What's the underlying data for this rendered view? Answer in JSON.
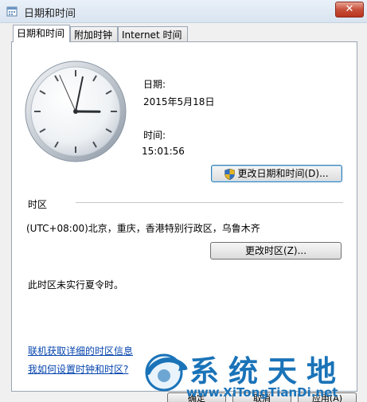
{
  "window": {
    "title": "日期和时间",
    "close_label": "✕"
  },
  "tabs": [
    {
      "label": "日期和时间"
    },
    {
      "label": "附加时钟"
    },
    {
      "label": "Internet 时间"
    }
  ],
  "clock": {
    "hour": 15,
    "minute": 1,
    "second": 56
  },
  "date": {
    "label": "日期:",
    "value": "2015年5月18日"
  },
  "time": {
    "label": "时间:",
    "value": "15:01:56"
  },
  "change_datetime_button": "更改日期和时间(D)...",
  "timezone": {
    "section_label": "时区",
    "value": "(UTC+08:00)北京，重庆，香港特别行政区，乌鲁木齐",
    "change_button": "更改时区(Z)...",
    "dst_note": "此时区未实行夏令时。"
  },
  "links": {
    "timezone_info": "联机获取详细的时区信息",
    "how_to_set": "我如何设置时钟和时区?"
  },
  "bottom_buttons": [
    {
      "label": "确定"
    },
    {
      "label": "取消"
    },
    {
      "label": "应用(A)"
    }
  ],
  "watermark": {
    "text": "系统天地",
    "url": "www.XiTongTianDi.net"
  },
  "colors": {
    "accent": "#1a73b8",
    "link": "#0645ad",
    "close": "#c7503a"
  }
}
